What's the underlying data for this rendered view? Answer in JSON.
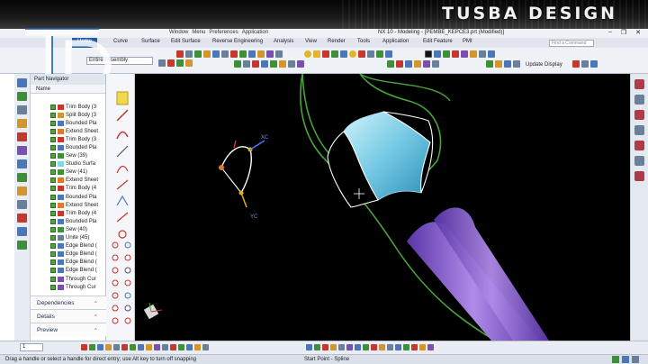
{
  "brand": "TUSBA DESIGN",
  "titlebar": {
    "quick_items": [
      "Window",
      "Menu",
      "Preferences",
      "Application"
    ],
    "document_title": "NX 10 - Modeling - [PEMBE_KEPCE3.prt (Modified)]"
  },
  "menu": {
    "tabs": [
      "Home",
      "Curve",
      "Surface",
      "Edit Surface",
      "Reverse Engineering",
      "Analysis",
      "View",
      "Render",
      "Tools",
      "Application",
      "Edit Feature",
      "PMI"
    ]
  },
  "search": {
    "placeholder": "Find a Command"
  },
  "filter": {
    "value": "Entire Assembly"
  },
  "update_display_label": "Update Display",
  "navigator": {
    "title": "Part Navigator",
    "column": "Name",
    "items": [
      {
        "label": "Trim Body (3",
        "icon": "trim-body-icon"
      },
      {
        "label": "Split Body (3",
        "icon": "split-body-icon"
      },
      {
        "label": "Bounded Pla",
        "icon": "bounded-plane-icon"
      },
      {
        "label": "Extend Sheet",
        "icon": "extend-sheet-icon"
      },
      {
        "label": "Trim Body (3",
        "icon": "trim-body-icon"
      },
      {
        "label": "Bounded Pla",
        "icon": "bounded-plane-icon"
      },
      {
        "label": "Sew (39)",
        "icon": "sew-icon"
      },
      {
        "label": "Studio Surfa",
        "icon": "studio-surface-icon"
      },
      {
        "label": "Sew (41)",
        "icon": "sew-icon"
      },
      {
        "label": "Extend Sheet",
        "icon": "extend-sheet-icon"
      },
      {
        "label": "Trim Body (4",
        "icon": "trim-body-icon"
      },
      {
        "label": "Bounded Pla",
        "icon": "bounded-plane-icon"
      },
      {
        "label": "Extend Sheet",
        "icon": "extend-sheet-icon"
      },
      {
        "label": "Trim Body (4",
        "icon": "trim-body-icon"
      },
      {
        "label": "Bounded Pla",
        "icon": "bounded-plane-icon"
      },
      {
        "label": "Sew (40)",
        "icon": "sew-icon"
      },
      {
        "label": "Unite (45)",
        "icon": "unite-icon"
      },
      {
        "label": "Edge Blend (",
        "icon": "edge-blend-icon"
      },
      {
        "label": "Edge Blend (",
        "icon": "edge-blend-icon"
      },
      {
        "label": "Edge Blend (",
        "icon": "edge-blend-icon"
      },
      {
        "label": "Edge Blend (",
        "icon": "edge-blend-icon"
      },
      {
        "label": "Through Cur",
        "icon": "through-curves-icon"
      },
      {
        "label": "Through Cur",
        "icon": "through-curves-icon"
      }
    ],
    "sections": [
      "Dependencies",
      "Details",
      "Preview"
    ]
  },
  "viewport": {
    "axis_labels": {
      "x": "XC",
      "y": "YC"
    }
  },
  "bottom": {
    "selector_value": "1"
  },
  "status": {
    "message": "Drag a handle or select a handle for direct entry; use Alt key to turn off snapping",
    "prompt": "Start Point - Spline"
  },
  "colors": {
    "ribbon_accent": "#1e5aa8",
    "viewport_bg": "#000000",
    "curve_green": "#46a535",
    "cyan_surface": "#7fd7ee",
    "purple_cone": "#8a5cd0"
  }
}
